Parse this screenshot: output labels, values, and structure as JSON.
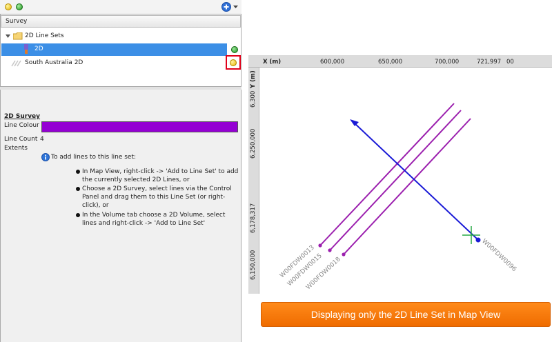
{
  "panel": {
    "header": "Survey",
    "tree": {
      "group_label": "2D Line Sets",
      "selected_item": "2D",
      "other_item": "South Australia 2D"
    }
  },
  "properties": {
    "section_title": "2D Survey",
    "line_colour_label": "Line Colour",
    "line_colour": "#9400d3",
    "line_count_label": "Line Count",
    "line_count": "4",
    "extents_label": "Extents",
    "info_text": "To add lines to this line set:",
    "bullets": [
      "In Map View, right-click -> 'Add to Line Set' to add the currently selected 2D Lines, or",
      "Choose a 2D Survey, select lines via the Control Panel and drag them to this Line Set (or right-click), or",
      "In the Volume tab choose a 2D Volume, select lines and right-click -> 'Add to Line Set'"
    ]
  },
  "map": {
    "x_axis_label": "X (m)",
    "y_axis_label": "Y (m)",
    "x_ticks": [
      "600,000",
      "650,000",
      "700,000",
      "721,997",
      "00"
    ],
    "y_ticks": [
      "6,300",
      "6,250,000",
      "6,178,317",
      "6,150,000"
    ],
    "line_names": [
      "W00FDW0013",
      "W00FDW0015",
      "W00FDW0018",
      "W00FDW0096"
    ],
    "line_color": "#9b1fae",
    "arrow_color": "#1a1ad6",
    "cursor_color": "#27a844"
  },
  "banner": {
    "text": "Displaying only the 2D Line Set in Map View"
  },
  "colors": {
    "status_green": "#2eaa2e",
    "status_yellow": "#ffc400",
    "highlight_border": "#e0001a",
    "banner": "#f57c00"
  }
}
